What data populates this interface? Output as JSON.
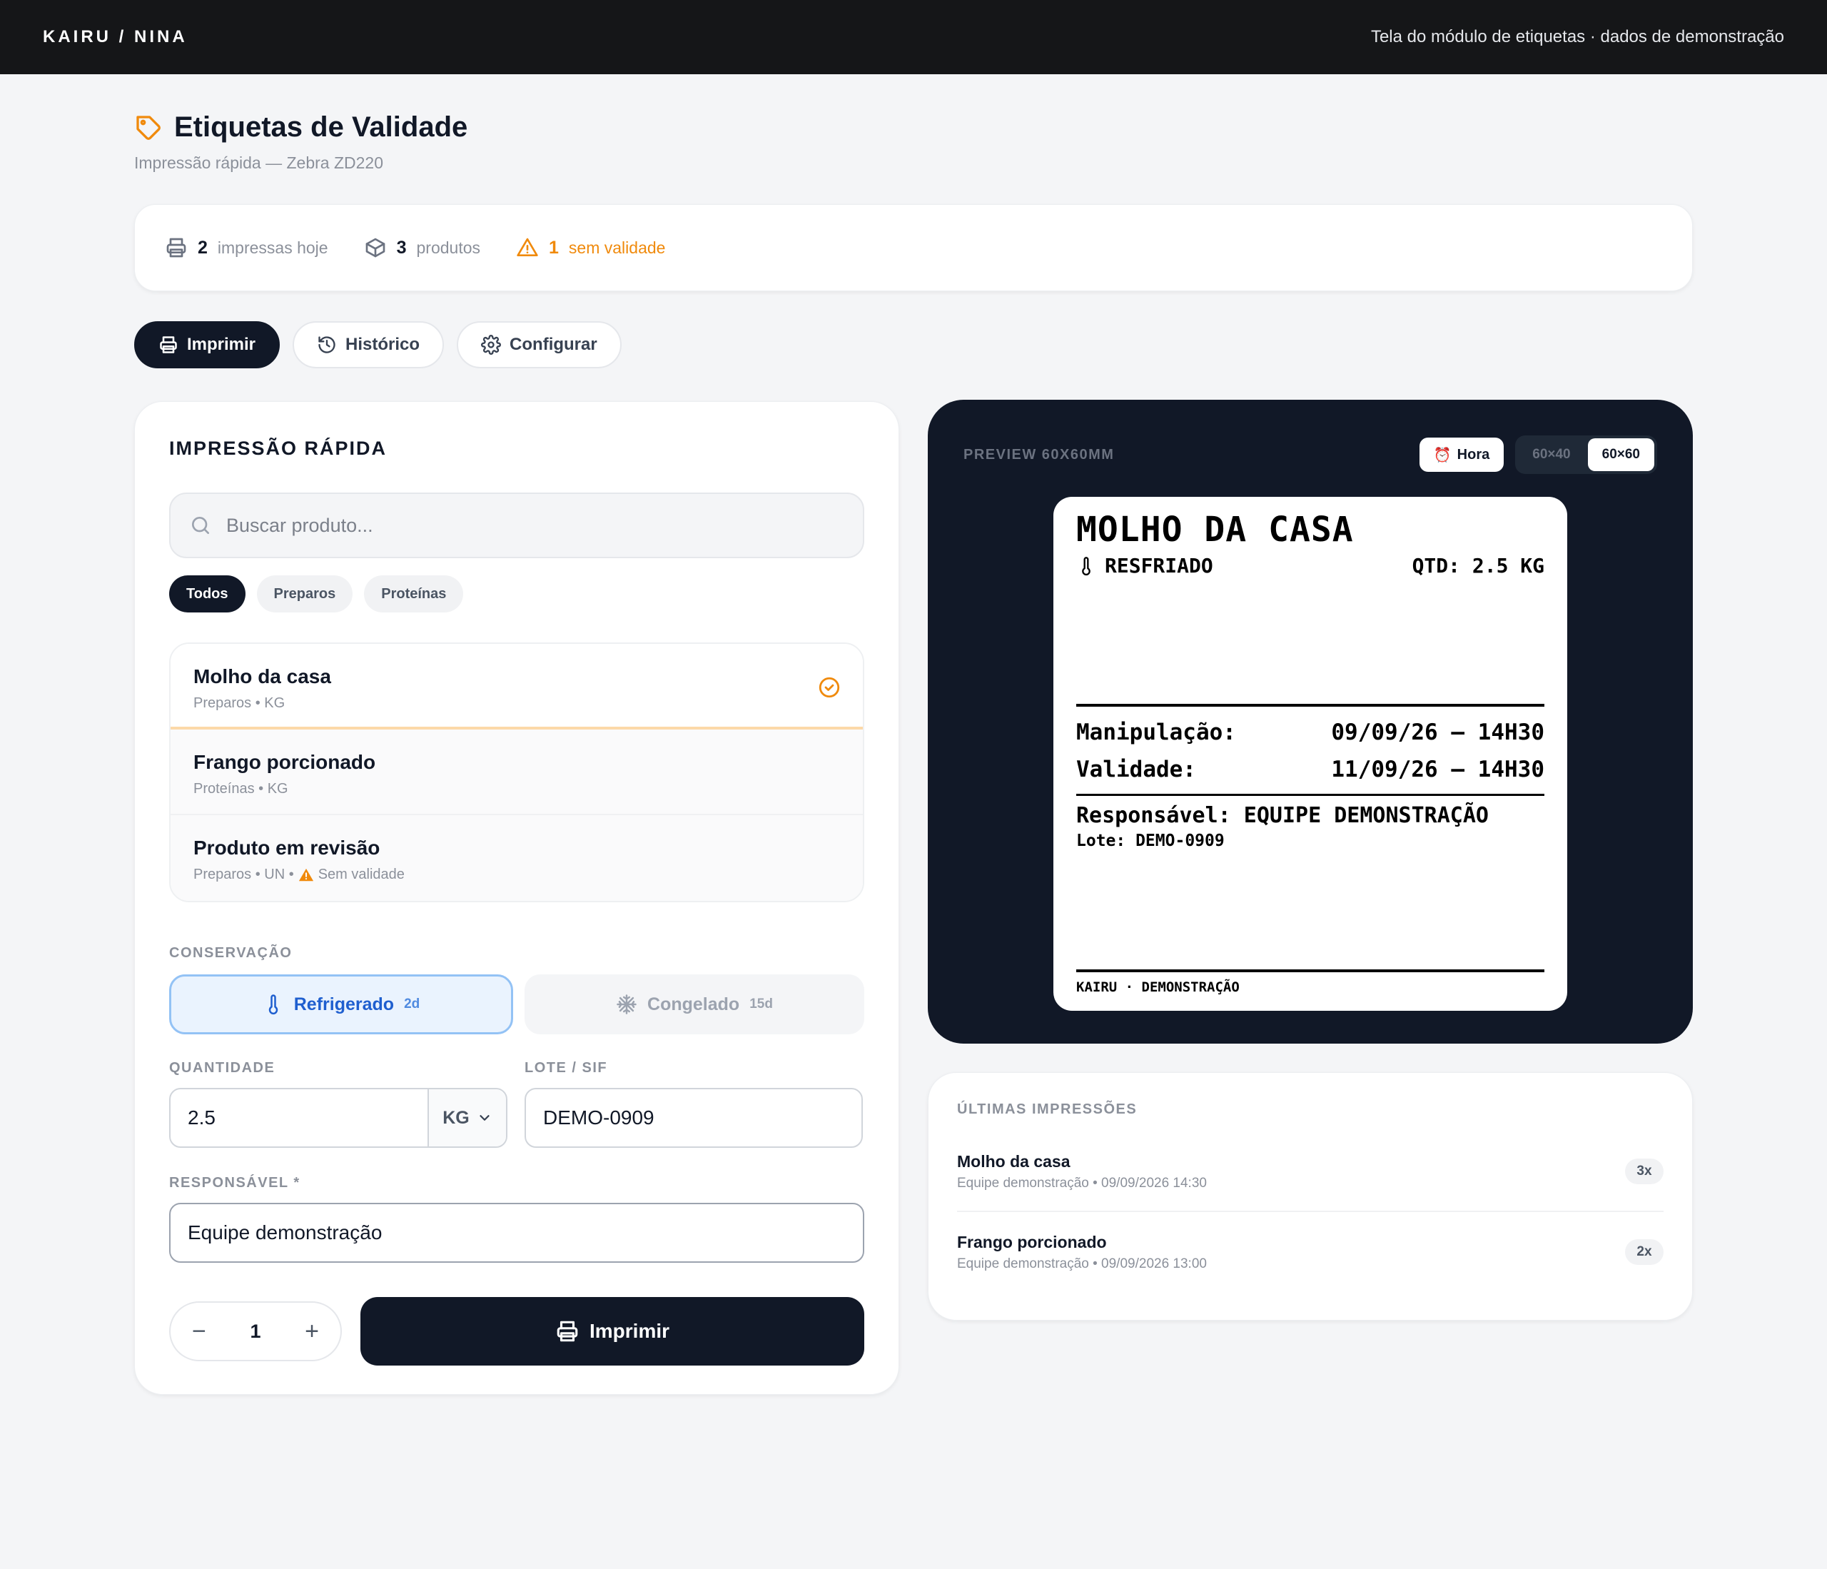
{
  "topbar": {
    "brand": "KAIRU / NINA",
    "note": "Tela do módulo de etiquetas · dados de demonstração"
  },
  "header": {
    "title": "Etiquetas de Validade",
    "subtitle": "Impressão rápida — Zebra ZD220"
  },
  "stats": {
    "printed_count": "2",
    "printed_label": "impressas hoje",
    "products_count": "3",
    "products_label": "produtos",
    "no_validity_count": "1",
    "no_validity_label": "sem validade"
  },
  "actions": {
    "print": "Imprimir",
    "history": "Histórico",
    "configure": "Configurar"
  },
  "quick_print": {
    "title": "IMPRESSÃO RÁPIDA",
    "search_placeholder": "Buscar produto...",
    "chips": [
      "Todos",
      "Preparos",
      "Proteínas"
    ],
    "products": [
      {
        "name": "Molho da casa",
        "meta": "Preparos • KG"
      },
      {
        "name": "Frango porcionado",
        "meta": "Proteínas • KG"
      },
      {
        "name": "Produto em revisão",
        "meta": "Preparos • UN •",
        "warning": "Sem validade"
      }
    ],
    "conservation_label": "CONSERVAÇÃO",
    "refrigerated": {
      "label": "Refrigerado",
      "days": "2d"
    },
    "frozen": {
      "label": "Congelado",
      "days": "15d"
    },
    "quantity_label": "QUANTIDADE",
    "quantity_value": "2.5",
    "unit_value": "KG",
    "lote_label": "LOTE / SIF",
    "lote_value": "DEMO-0909",
    "responsible_label": "RESPONSÁVEL *",
    "responsible_value": "Equipe demonstração",
    "copies": "1",
    "minus": "−",
    "plus": "+",
    "print_button": "Imprimir"
  },
  "preview": {
    "title": "PREVIEW 60X60MM",
    "hour_button": "Hora",
    "sizes": [
      "60×40",
      "60×60"
    ],
    "label": {
      "product": "MOLHO DA CASA",
      "conservation": "RESFRIADO",
      "quantity": "QTD: 2.5 KG",
      "handling_key": "Manipulação:",
      "handling_value": "09/09/26 – 14H30",
      "validity_key": "Validade:",
      "validity_value": "11/09/26 – 14H30",
      "responsible": "Responsável: EQUIPE DEMONSTRAÇÃO",
      "lote": "Lote: DEMO-0909",
      "footer": "KAIRU · DEMONSTRAÇÃO"
    }
  },
  "recent": {
    "title": "ÚLTIMAS IMPRESSÕES",
    "items": [
      {
        "name": "Molho da casa",
        "meta": "Equipe demonstração • 09/09/2026 14:30",
        "count": "3x"
      },
      {
        "name": "Frango porcionado",
        "meta": "Equipe demonstração • 09/09/2026 13:00",
        "count": "2x"
      }
    ]
  },
  "colors": {
    "accent": "#f08a0c",
    "dark": "#111827",
    "primary_blue": "#1f5fcf"
  }
}
